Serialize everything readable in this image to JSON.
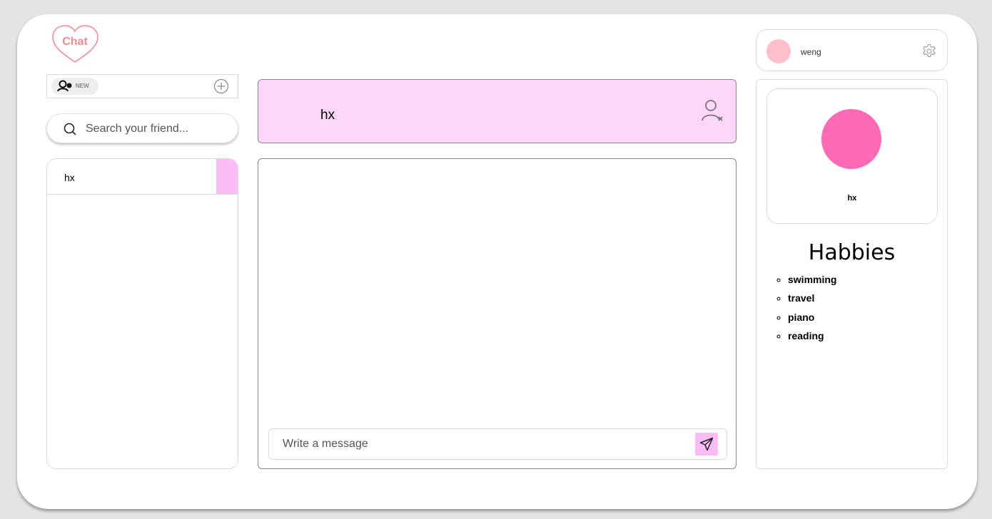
{
  "logo": {
    "text": "Chat"
  },
  "new_friend": {
    "label": "NEW"
  },
  "search": {
    "placeholder": "Search your friend..."
  },
  "friends": [
    {
      "name": "hx"
    }
  ],
  "chat": {
    "partner_name": "hx",
    "message_placeholder": "Write a message"
  },
  "user": {
    "name": "weng"
  },
  "profile": {
    "name": "hx",
    "hobbies_title": "Habbies",
    "hobbies": [
      "swimming",
      "travel",
      "piano",
      "reading"
    ]
  },
  "colors": {
    "accent_pink": "#fbbcf7",
    "header_pink": "#fdd6fa",
    "profile_avatar": "#ff6ab5",
    "user_avatar": "#ffbfcb",
    "logo_pink": "#f08c94"
  },
  "icons": {
    "logo": "heart-logo-icon",
    "new_friend": "add-user-icon",
    "add": "plus-circle-icon",
    "search": "search-icon",
    "remove_friend": "remove-user-icon",
    "send": "send-icon",
    "settings": "gear-icon"
  }
}
